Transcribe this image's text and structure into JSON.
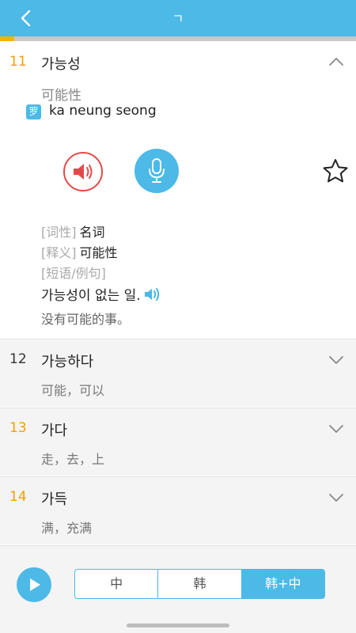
{
  "header": {
    "title": "ㄱ"
  },
  "progress": {
    "fraction": 0.04
  },
  "colors": {
    "accent": "#4cb9e7",
    "highlight": "#f0a000",
    "speaker": "#e24a4a"
  },
  "open_entry": {
    "number": "11",
    "word": "가능성",
    "meaning": "可能性",
    "romanization_icon": "罗",
    "romanization": "ka neung seong",
    "pos_label": "[词性]",
    "pos_value": "名词",
    "def_label": "[释义]",
    "def_value": "可能性",
    "phrase_label": "[短语/例句]",
    "example_ko": "가능성이 없는 일.",
    "example_zh": "没有可能的事。"
  },
  "entries": [
    {
      "number": "12",
      "word": "가능하다",
      "meaning": "可能，可以"
    },
    {
      "number": "13",
      "word": "가다",
      "meaning": "走，去，上"
    },
    {
      "number": "14",
      "word": "가득",
      "meaning": "满，充满"
    }
  ],
  "bottom": {
    "modes": [
      "中",
      "韩",
      "韩+中"
    ],
    "selected_mode": "韩+中"
  },
  "icons": [
    "back-arrow-icon",
    "chevron-up-icon",
    "chevron-down-icon",
    "speaker-icon",
    "microphone-icon",
    "star-icon",
    "play-icon"
  ]
}
